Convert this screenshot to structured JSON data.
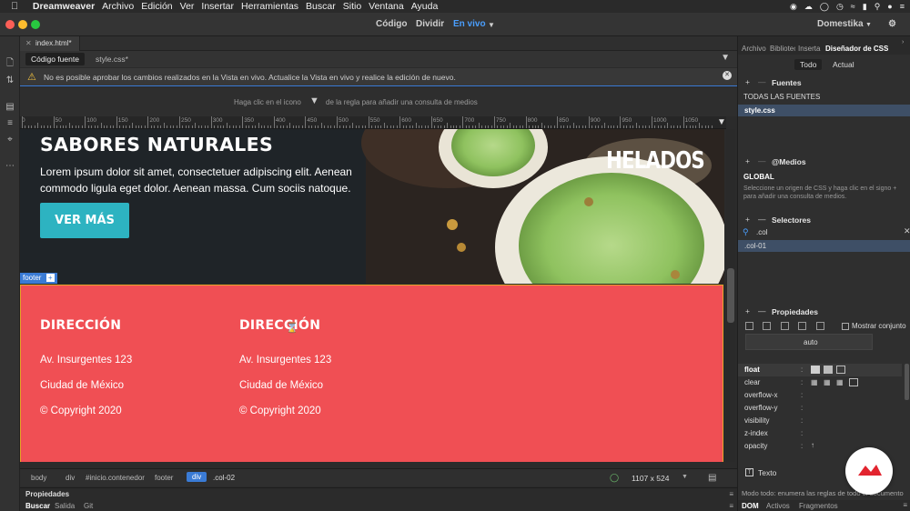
{
  "menubar": {
    "app": "Dreamweaver",
    "items": [
      "Archivo",
      "Edición",
      "Ver",
      "Insertar",
      "Herramientas",
      "Buscar",
      "Sitio",
      "Ventana",
      "Ayuda"
    ]
  },
  "titlebar": {
    "views": [
      "Código",
      "Dividir",
      "En vivo"
    ],
    "workspace": "Domestika"
  },
  "doctabs": {
    "active": "index.html*"
  },
  "srcbar": {
    "tabs": [
      "Código fuente",
      "style.css*"
    ]
  },
  "warning": {
    "text": "No es posible aprobar los cambios realizados en la Vista en vivo. Actualice la Vista en vivo y realice la edición de nuevo."
  },
  "mediaquery": {
    "text_before": "Haga clic en el icono",
    "text_after": "de la regla para añadir una consulta de medios"
  },
  "ruler": {
    "ticks": [
      "0",
      "50",
      "100",
      "150",
      "200",
      "250",
      "300",
      "350",
      "400",
      "450",
      "500",
      "550",
      "600",
      "650",
      "700",
      "750",
      "800",
      "850",
      "900",
      "950",
      "1000",
      "1050"
    ]
  },
  "hero": {
    "title": "SABORES NATURALES",
    "body": "Lorem ipsum dolor sit amet, consectetuer adipiscing elit. Aenean commodo ligula eget dolor. Aenean massa. Cum sociis natoque.",
    "button": "VER MÁS",
    "brand": "HELADOS"
  },
  "footer": {
    "tag": "footer",
    "cols": [
      {
        "title": "DIRECCIÓN",
        "lines": [
          "Av. Insurgentes 123",
          "Ciudad de México",
          "© Copyright 2020"
        ]
      },
      {
        "title": "DIRECCIÓN",
        "lines": [
          "Av. Insurgentes 123",
          "Ciudad de México",
          "© Copyright 2020"
        ]
      }
    ]
  },
  "statusbar": {
    "crumbs": [
      "body",
      "div",
      "#inicio.contenedor",
      "footer",
      "div",
      ".col-02"
    ],
    "size": "1107 x 524"
  },
  "bottompanel": {
    "title": "Propiedades",
    "tabs": [
      "Buscar",
      "Salida",
      "Git"
    ]
  },
  "rightpanel": {
    "tabs": [
      "Archivo",
      "Biblioteca",
      "Inserta",
      "Diseñador de CSS"
    ],
    "toggle": [
      "Todo",
      "Actual"
    ],
    "sources": {
      "title": "Fuentes",
      "items": [
        "TODAS LAS FUENTES",
        "style.css"
      ]
    },
    "medios": {
      "title": "@Medios",
      "global": "GLOBAL",
      "hint": "Seleccione un origen de CSS y haga clic en el signo + para añadir una consulta de medios."
    },
    "selectores": {
      "title": "Selectores",
      "filter": ".col",
      "items": [
        ".col-01"
      ]
    },
    "propiedades": {
      "title": "Propiedades",
      "show_all": "Mostrar conjunto",
      "auto": "auto",
      "rows": [
        "float",
        "clear",
        "overflow-x",
        "overflow-y",
        "visibility",
        "z-index",
        "opacity"
      ]
    },
    "texto": "Texto",
    "footnote": "Modo todo: enumera las reglas de todo el documento",
    "bottomtabs": [
      "DOM",
      "Activos",
      "Fragmentos"
    ]
  },
  "colors": {
    "accent": "#3a7bd5",
    "footer_bg": "#f04f54",
    "button": "#2db3c1"
  }
}
